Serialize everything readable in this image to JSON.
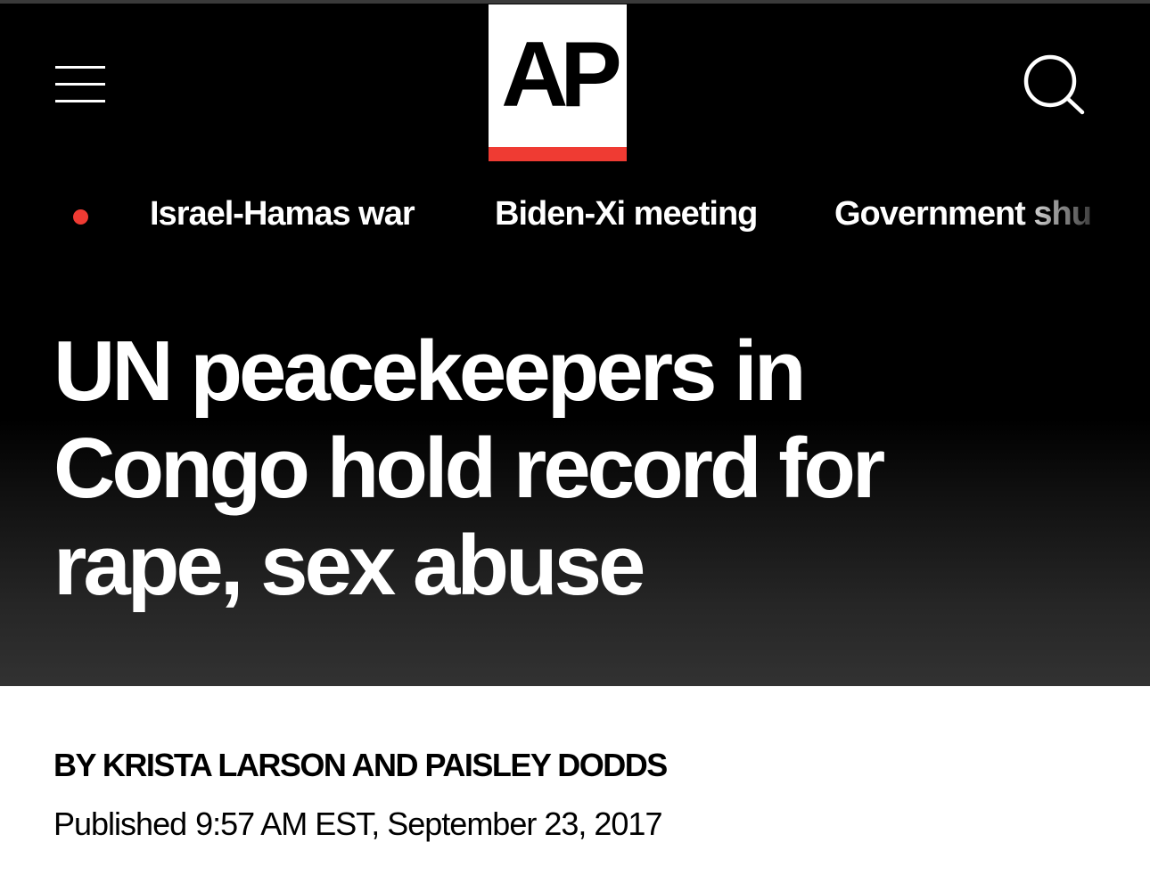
{
  "header": {
    "logo_text": "AP",
    "menu_icon": "hamburger-menu-icon",
    "search_icon": "search-icon",
    "brand_red": "#ef3b33",
    "background": "#000000"
  },
  "trending": {
    "live_indicator_color": "#ef3b33",
    "items": [
      {
        "label": "Israel-Hamas war"
      },
      {
        "label": "Biden-Xi meeting"
      },
      {
        "label": "Government shu"
      }
    ]
  },
  "article": {
    "headline": "UN peacekeepers in Congo hold record for rape, sex abuse",
    "byline": "BY KRISTA LARSON AND PAISLEY DODDS",
    "published_label": "Published",
    "published_datetime": "9:57 AM EST, September 23, 2017"
  }
}
